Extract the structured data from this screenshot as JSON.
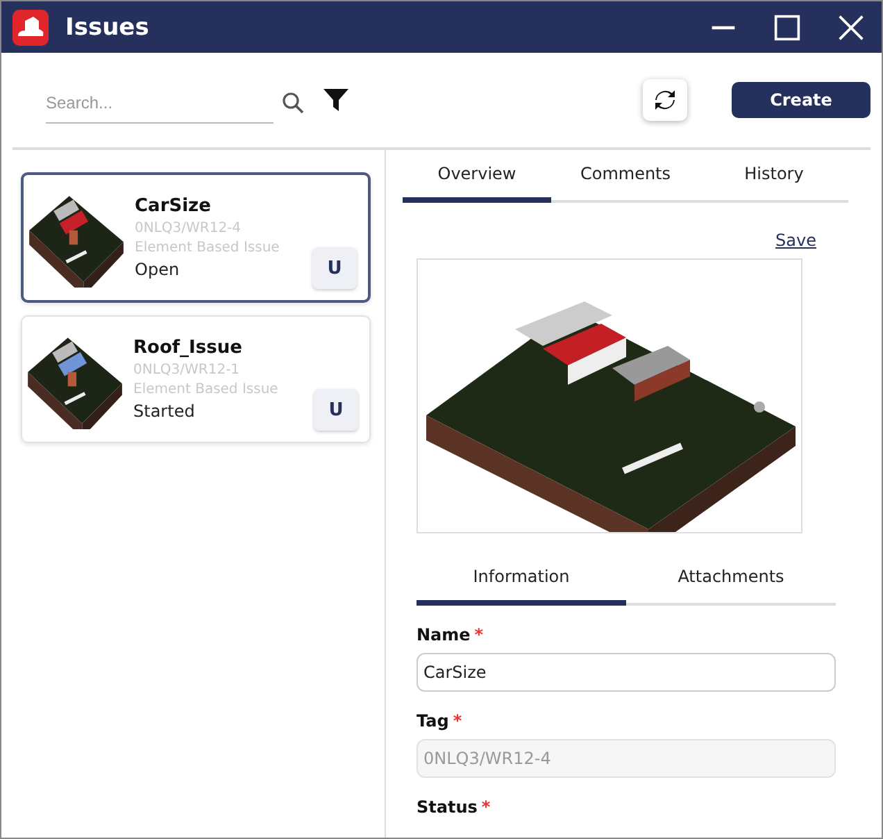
{
  "window": {
    "title": "Issues"
  },
  "toolbar": {
    "search": {
      "placeholder": "Search..."
    },
    "create_button": "Create"
  },
  "issues": [
    {
      "name": "CarSize",
      "tag": "0NLQ3/WR12-4",
      "type": "Element Based Issue",
      "status": "Open",
      "avatar": "U",
      "selected": true,
      "color": "#c8202a"
    },
    {
      "name": "Roof_Issue",
      "tag": "0NLQ3/WR12-1",
      "type": "Element Based Issue",
      "status": "Started",
      "avatar": "U",
      "selected": false,
      "color": "#6f95d8"
    }
  ],
  "detail_tabs": [
    {
      "label": "Overview",
      "selected": true
    },
    {
      "label": "Comments",
      "selected": false
    },
    {
      "label": "History",
      "selected": false
    }
  ],
  "save_link": "Save",
  "info_tabs": [
    {
      "label": "Information",
      "selected": true
    },
    {
      "label": "Attachments",
      "selected": false
    }
  ],
  "fields": [
    {
      "label": "Name",
      "required_mark": "*",
      "value": "CarSize",
      "disabled": false
    },
    {
      "label": "Tag",
      "required_mark": "*",
      "value": "0NLQ3/WR12-4",
      "disabled": true
    },
    {
      "label": "Status",
      "required_mark": "*"
    }
  ]
}
